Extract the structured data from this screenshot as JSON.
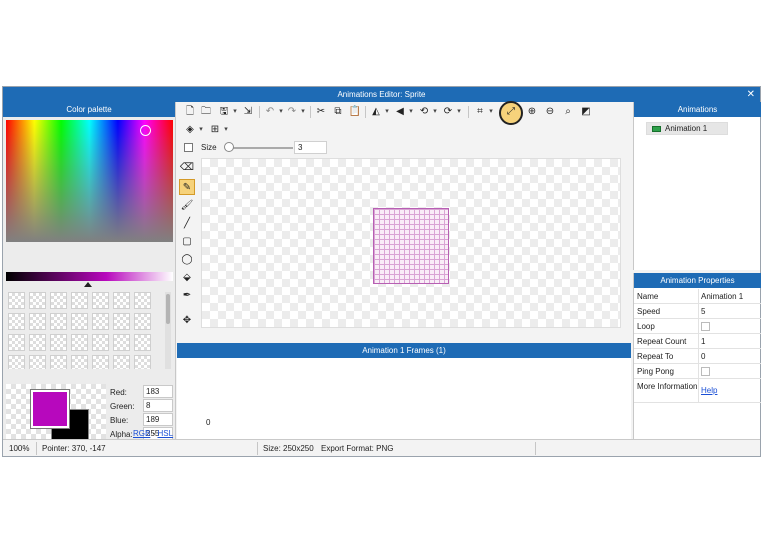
{
  "window": {
    "title": "Animations Editor: Sprite",
    "close_glyph": "✕"
  },
  "palette": {
    "header": "Color palette",
    "current_color": "#b708bd",
    "secondary_color": "#000000",
    "red_label": "Red:",
    "red": "183",
    "green_label": "Green:",
    "green": "8",
    "blue_label": "Blue:",
    "blue": "189",
    "alpha_label": "Alpha:",
    "alpha": "255",
    "rgb_link": "RGB",
    "link_sep": "-",
    "hsl_link": "HSL"
  },
  "toolbar": {
    "icons": [
      "new-file-icon",
      "open-folder-icon",
      "save-icon",
      "save-dropdown",
      "export-icon",
      "undo-icon",
      "undo-dropdown",
      "redo-icon",
      "redo-dropdown",
      "cut-icon",
      "copy-icon",
      "paste-icon",
      "flip-horizontal-icon",
      "flip-dropdown",
      "flip-vertical-icon",
      "flip-v-dropdown",
      "rotate-left-icon",
      "rotate-left-dropdown",
      "rotate-right-icon",
      "rotate-right-dropdown",
      "crop-icon",
      "crop-dropdown",
      "resize-icon",
      "zoom-in-icon",
      "zoom-out-icon",
      "zoom-fit-icon",
      "actual-size-icon"
    ],
    "row2": [
      "layers-icon",
      "layers-dropdown",
      "grid-icon",
      "grid-dropdown"
    ]
  },
  "size": {
    "label": "Size",
    "value": "3"
  },
  "tools": [
    "eraser-icon",
    "pencil-icon",
    "brush-icon",
    "line-icon",
    "rectangle-icon",
    "ellipse-icon",
    "fill-bucket-icon",
    "eyedropper-icon",
    "move-icon"
  ],
  "frames": {
    "header": "Animation 1 Frames (1)",
    "frame_index": "0"
  },
  "animations": {
    "header": "Animations",
    "items": [
      {
        "label": "Animation 1"
      }
    ]
  },
  "properties": {
    "header": "Animation Properties",
    "rows": [
      {
        "key": "Name",
        "value": "Animation 1"
      },
      {
        "key": "Speed",
        "value": "5"
      },
      {
        "key": "Loop",
        "value": ""
      },
      {
        "key": "Repeat Count",
        "value": "1"
      },
      {
        "key": "Repeat To",
        "value": "0"
      },
      {
        "key": "Ping Pong",
        "value": ""
      },
      {
        "key": "More Information",
        "value": "Help"
      }
    ]
  },
  "status": {
    "zoom": "100%",
    "pointer": "Pointer: 370, -147",
    "size": "Size: 250x250",
    "export_format": "Export Format: PNG"
  }
}
